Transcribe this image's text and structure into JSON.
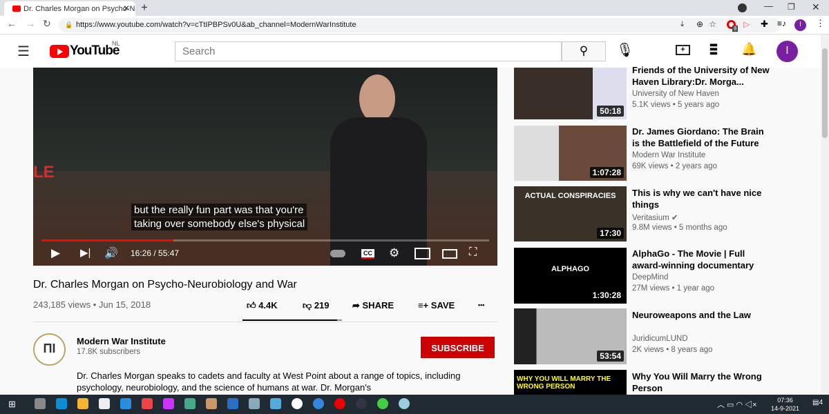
{
  "browser": {
    "tab_title": "Dr. Charles Morgan on Psycho-Ne",
    "new_tab": "+",
    "url": "https://www.youtube.com/watch?v=cTtIPBPSv0U&ab_channel=ModernWarInstitute",
    "profile_initial": "I",
    "extension_badge": "8"
  },
  "header": {
    "logo_text": "YouTube",
    "region": "NL",
    "search_placeholder": "Search",
    "avatar_initial": "I"
  },
  "player": {
    "subtitle_line1": "but the really fun part was that you're",
    "subtitle_line2": "taking over somebody else's physical",
    "time": "16:26 / 55:47",
    "progress_percent": 29.4,
    "cc_label": "CC",
    "board_text": "LE"
  },
  "video": {
    "title": "Dr. Charles Morgan on Psycho-Neurobiology and War",
    "views_date": "243,185 views • Jun 15, 2018",
    "likes": "4.4K",
    "dislikes": "219",
    "share": "SHARE",
    "save": "SAVE",
    "more": "•••",
    "like_ratio": 0.95
  },
  "channel": {
    "name": "Modern War Institute",
    "subscribers": "17.8K subscribers",
    "subscribe": "SUBSCRIBE",
    "description": "Dr. Charles Morgan speaks to cadets and faculty at West Point about a range of topics, including psychology, neurobiology, and the science of humans at war. Dr. Morgan's"
  },
  "related": [
    {
      "title": "Friends of the University of New Haven Library:Dr. Morga...",
      "channel": "University of New Haven",
      "meta": "5.1K views • 5 years ago",
      "duration": "50:18"
    },
    {
      "title": "Dr. James Giordano: The Brain is the Battlefield of the Future",
      "channel": "Modern War Institute",
      "meta": "69K views • 2 years ago",
      "duration": "1:07:28"
    },
    {
      "title": "This is why we can't have nice things",
      "channel": "Veritasium",
      "verified": true,
      "meta": "9.8M views • 5 months ago",
      "duration": "17:30",
      "thumb_text": "ACTUAL CONSPIRACIES"
    },
    {
      "title": "AlphaGo - The Movie | Full award-winning documentary",
      "channel": "DeepMind",
      "meta": "27M views • 1 year ago",
      "duration": "1:30:28",
      "thumb_text": "ALPHAGO"
    },
    {
      "title": "Neuroweapons and the Law",
      "channel": "JuridicumLUND",
      "meta": "2K views • 8 years ago",
      "duration": "53:54"
    },
    {
      "title": "Why You Will Marry the Wrong Person",
      "thumb_text": "WHY YOU WILL MARRY THE WRONG PERSON"
    }
  ],
  "taskbar": {
    "time": "07:36",
    "date": "14-9-2021",
    "notifications": "4"
  },
  "colors": {
    "youtube_red": "#ff0000",
    "subscribe": "#cc0000",
    "avatar": "#7b1fa2",
    "taskbar": "#1f2a33"
  }
}
